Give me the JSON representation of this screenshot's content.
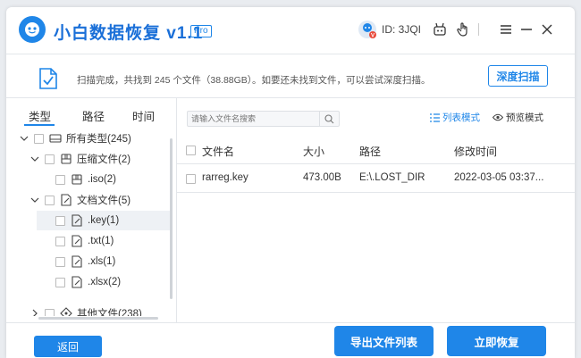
{
  "header": {
    "title": "小白数据恢复",
    "version": "v1.1",
    "badge": "Pro",
    "user_id": "ID: 3JQI"
  },
  "scan": {
    "summary": "扫描完成，共找到 245 个文件（38.88GB）。如要还未找到文件，可以尝试深度扫描。",
    "deep_scan_label": "深度扫描"
  },
  "left_tabs": {
    "type": "类型",
    "path": "路径",
    "time": "时间"
  },
  "tree": [
    {
      "label": "所有类型(245)"
    },
    {
      "label": "压缩文件(2)"
    },
    {
      "label": ".iso(2)"
    },
    {
      "label": "文档文件(5)"
    },
    {
      "label": ".key(1)"
    },
    {
      "label": ".txt(1)"
    },
    {
      "label": ".xls(1)"
    },
    {
      "label": ".xlsx(2)"
    },
    {
      "label": "其他文件(238)"
    }
  ],
  "search": {
    "placeholder": "请输入文件名搜索"
  },
  "view_modes": {
    "list": "列表模式",
    "preview": "预览模式"
  },
  "table": {
    "columns": [
      "文件名",
      "大小",
      "路径",
      "修改时间"
    ],
    "rows": [
      {
        "name": "rarreg.key",
        "size": "473.00B",
        "path": "E:\\.LOST_DIR",
        "modified": "2022-03-05 03:37..."
      }
    ]
  },
  "footer": {
    "back": "返回",
    "export": "导出文件列表",
    "recover": "立即恢复"
  },
  "colors": {
    "accent": "#1f86e8",
    "title": "#1a6fd8"
  }
}
